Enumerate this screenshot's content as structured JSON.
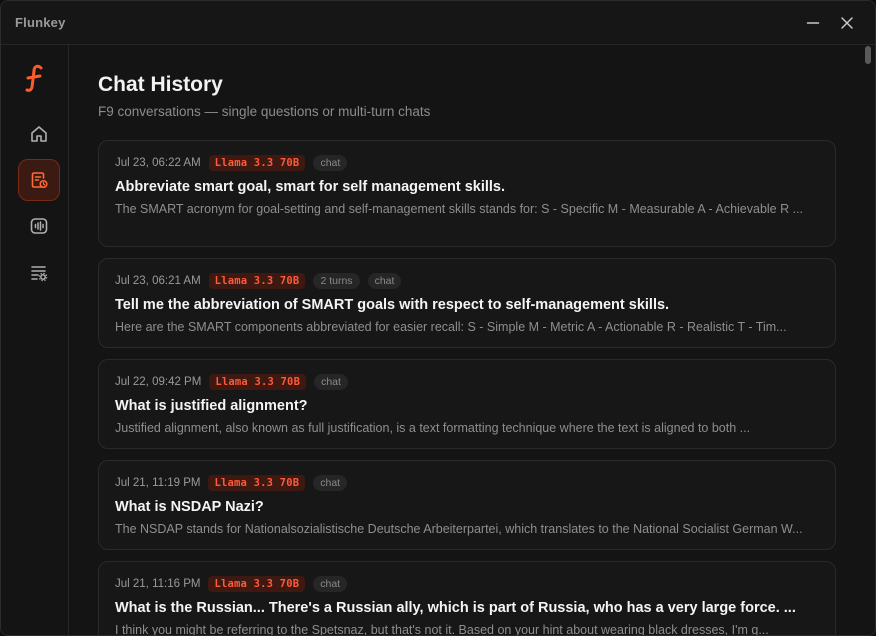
{
  "app": {
    "title": "Flunkey"
  },
  "colors": {
    "accent": "#ff5a3a",
    "accent_bg": "#3d1912",
    "background": "#141414",
    "card": "#171717"
  },
  "sidebar": {
    "items": [
      {
        "icon": "home-icon"
      },
      {
        "icon": "history-icon",
        "active": true
      },
      {
        "icon": "audio-waveform-icon"
      },
      {
        "icon": "settings-list-icon"
      }
    ]
  },
  "page": {
    "title": "Chat History",
    "subtitle": "F9 conversations — single questions or multi-turn chats"
  },
  "conversations": [
    {
      "date": "Jul 23, 06:22 AM",
      "model": "Llama 3.3 70B",
      "turns": "",
      "type": "chat",
      "title": "Abbreviate smart goal, smart for self management skills.",
      "preview": "The SMART acronym for goal-setting and self-management skills stands for: S - Specific M - Measurable A - Achievable R ..."
    },
    {
      "date": "Jul 23, 06:21 AM",
      "model": "Llama 3.3 70B",
      "turns": "2 turns",
      "type": "chat",
      "title": "Tell me the abbreviation of SMART goals with respect to self-management skills.",
      "preview": "Here are the SMART components abbreviated for easier recall: S - Simple M - Metric A - Actionable R - Realistic T - Tim..."
    },
    {
      "date": "Jul 22, 09:42 PM",
      "model": "Llama 3.3 70B",
      "turns": "",
      "type": "chat",
      "title": "What is justified alignment?",
      "preview": "Justified alignment, also known as full justification, is a text formatting technique where the text is aligned to both ..."
    },
    {
      "date": "Jul 21, 11:19 PM",
      "model": "Llama 3.3 70B",
      "turns": "",
      "type": "chat",
      "title": "What is NSDAP Nazi?",
      "preview": "The NSDAP stands for Nationalsozialistische Deutsche Arbeiterpartei, which translates to the National Socialist German W..."
    },
    {
      "date": "Jul 21, 11:16 PM",
      "model": "Llama 3.3 70B",
      "turns": "",
      "type": "chat",
      "title": "What is the Russian... There's a Russian ally, which is part of Russia, who has a very large force. ...",
      "preview": "I think you might be referring to the Spetsnaz, but that's not it. Based on your hint about wearing black dresses, I'm g..."
    }
  ]
}
